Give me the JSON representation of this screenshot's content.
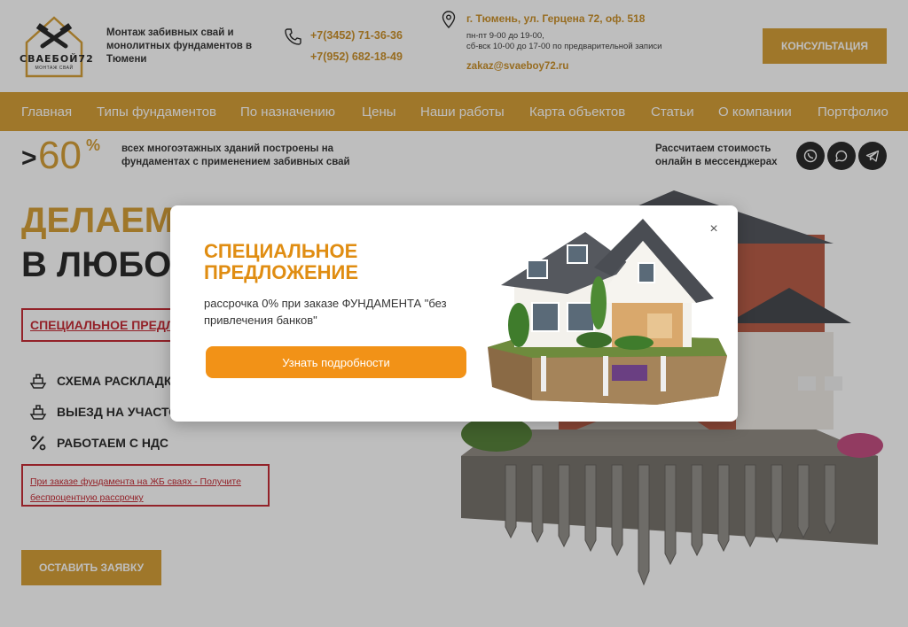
{
  "header": {
    "logo_text": "СВАЕБОЙ72",
    "logo_sub": "МОНТАЖ СВАЙ",
    "tagline": "Монтаж забивных свай и монолитных фундаментов в Тюмени",
    "phones": [
      "+7(3452) 71-36-36",
      "+7(952) 682-18-49"
    ],
    "address": "г. Тюмень, ул. Герцена 72, оф. 518",
    "hours": [
      "пн-пт 9-00 до 19-00,",
      "сб-вск 10-00 до 17-00 по предварительной записи"
    ],
    "email": "zakaz@svaeboy72.ru",
    "consult_label": "КОНСУЛЬТАЦИЯ"
  },
  "nav": {
    "items": [
      {
        "label": "Главная"
      },
      {
        "label": "Типы фундаментов"
      },
      {
        "label": "По назначению"
      },
      {
        "label": "Цены"
      },
      {
        "label": "Наши работы"
      },
      {
        "label": "Карта объектов"
      },
      {
        "label": "Статьи"
      },
      {
        "label": "О компании"
      },
      {
        "label": "Портфолио"
      }
    ]
  },
  "strip": {
    "gt": ">",
    "number": "60",
    "percent": "%",
    "text": "всех многоэтажных зданий построены на фундаментах с применением забивных свай",
    "calc_text": "Рассчитаем стоимость онлайн в мессенджерах",
    "messengers": [
      "viber-icon",
      "whatsapp-icon",
      "telegram-icon"
    ]
  },
  "hero": {
    "title_line1": "ДЕЛАЕМ Ф",
    "title_line2": "В ЛЮБОЕ В",
    "special_label": "СПЕЦИАЛЬНОЕ ПРЕДЛО",
    "features": [
      {
        "label": "СХЕМА РАСКЛАДКИ",
        "icon": "ship-icon"
      },
      {
        "label": "ВЫЕЗД НА УЧАСТО",
        "icon": "ship-icon"
      },
      {
        "label": "РАБОТАЕМ С НДС",
        "icon": "percent-icon"
      }
    ],
    "promo_link": "При заказе фундамента на ЖБ сваях - Получите беспроцентную рассрочку",
    "order_label": "ОСТАВИТЬ ЗАЯВКУ"
  },
  "modal": {
    "title": "СПЕЦИАЛЬНОЕ ПРЕДЛОЖЕНИЕ",
    "text": "рассрочка 0% при заказе ФУНДАМЕНТА \"без привлечения банков\"",
    "button_label": "Узнать подробности",
    "close_glyph": "×"
  },
  "colors": {
    "accent": "#d39a2c",
    "modal_accent": "#f29217",
    "alert": "#c2202a",
    "dark": "#1e1e1e"
  }
}
